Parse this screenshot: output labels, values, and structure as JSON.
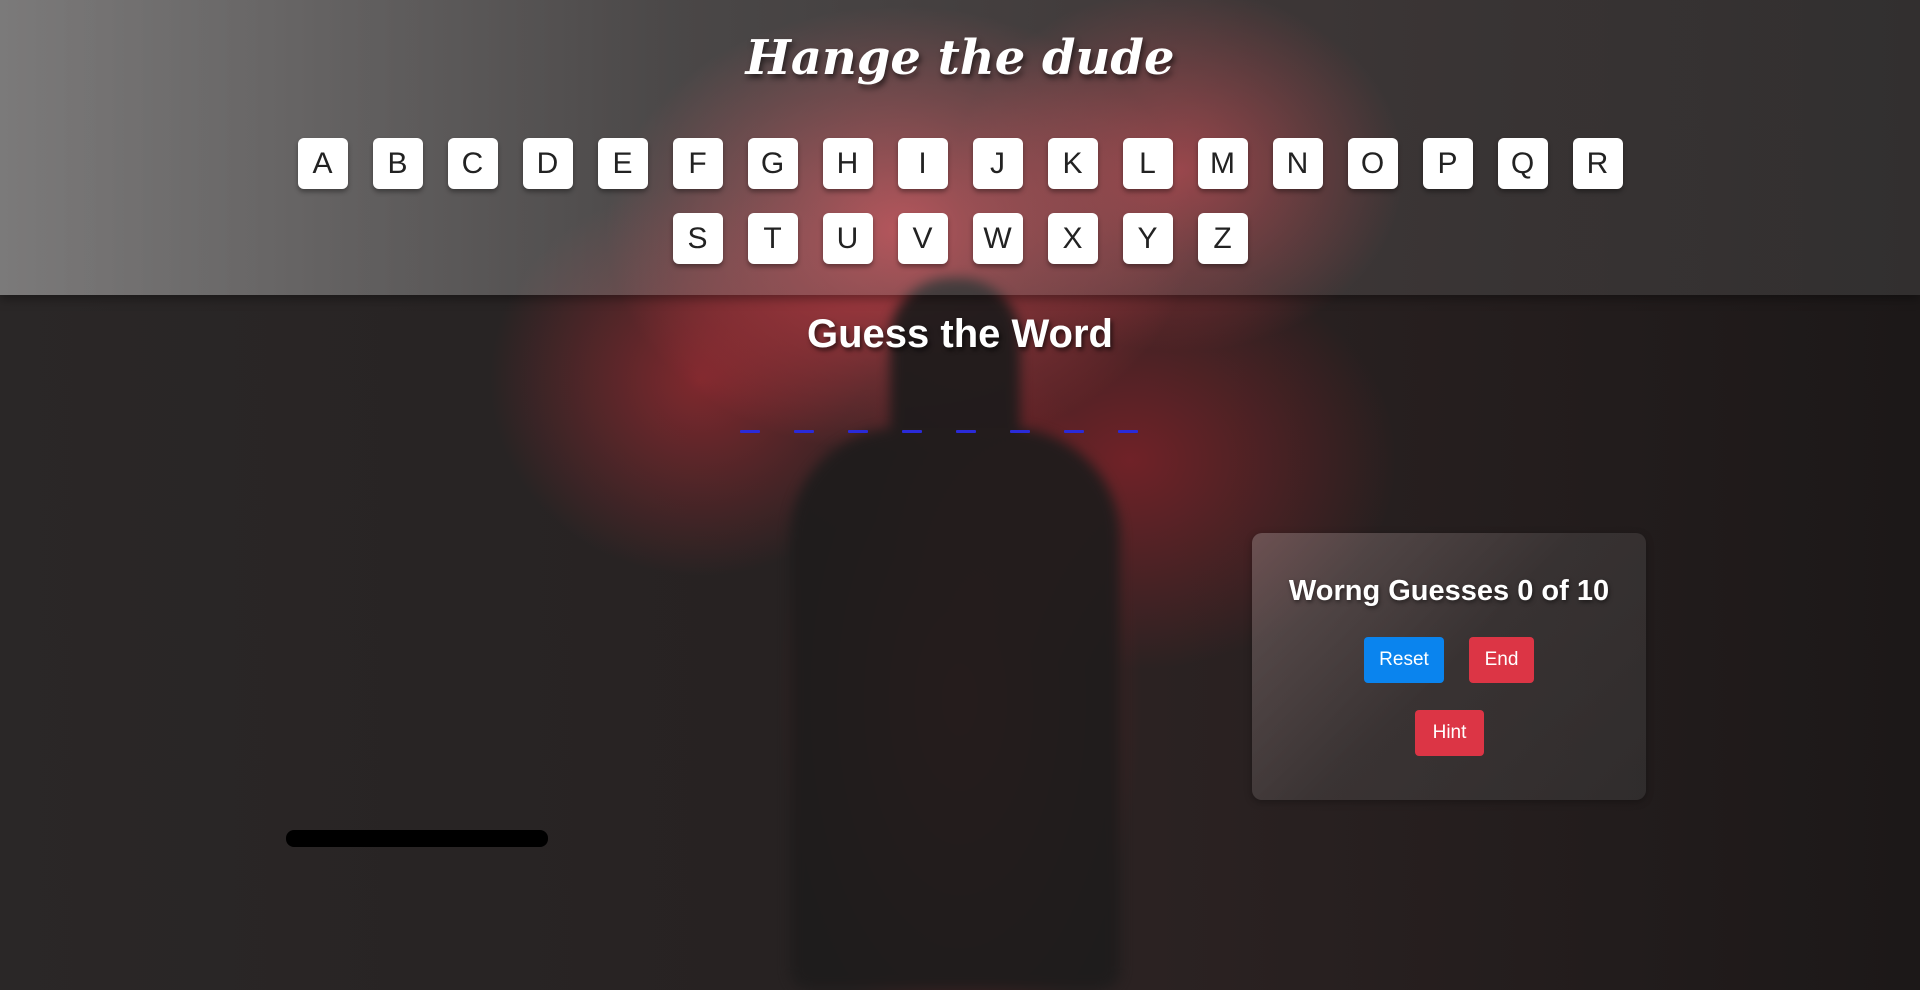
{
  "app": {
    "title": "Hange the dude"
  },
  "keyboard": {
    "rows": [
      [
        "A",
        "B",
        "C",
        "D",
        "E",
        "F",
        "G",
        "H",
        "I",
        "J",
        "K",
        "L",
        "M",
        "N",
        "O",
        "P",
        "Q",
        "R"
      ],
      [
        "S",
        "T",
        "U",
        "V",
        "W",
        "X",
        "Y",
        "Z"
      ]
    ]
  },
  "word": {
    "heading": "Guess the Word",
    "blank_count": 8,
    "blank_color": "#2a2ad8"
  },
  "panel": {
    "wrong_guesses_text": "Worng Guesses 0 of 10",
    "wrong_guesses": 0,
    "max_guesses": 10,
    "reset_label": "Reset",
    "end_label": "End",
    "hint_label": "Hint"
  },
  "colors": {
    "reset_button": "#0a84ee",
    "danger_button": "#dc3545",
    "key_background": "#ffffff"
  }
}
